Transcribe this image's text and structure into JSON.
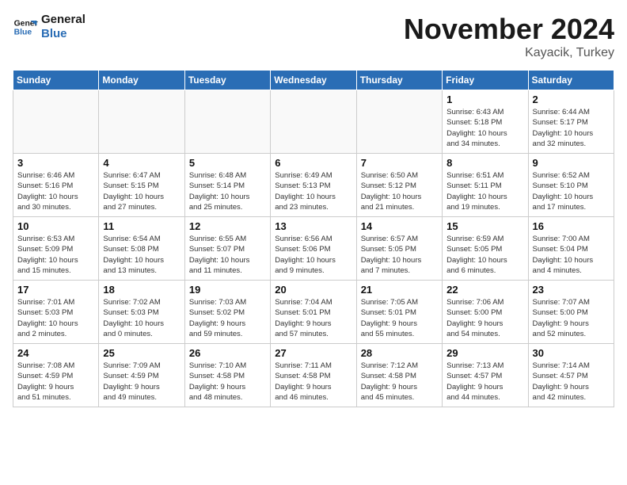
{
  "logo": {
    "line1": "General",
    "line2": "Blue"
  },
  "title": "November 2024",
  "location": "Kayacik, Turkey",
  "weekdays": [
    "Sunday",
    "Monday",
    "Tuesday",
    "Wednesday",
    "Thursday",
    "Friday",
    "Saturday"
  ],
  "weeks": [
    [
      {
        "day": "",
        "info": ""
      },
      {
        "day": "",
        "info": ""
      },
      {
        "day": "",
        "info": ""
      },
      {
        "day": "",
        "info": ""
      },
      {
        "day": "",
        "info": ""
      },
      {
        "day": "1",
        "info": "Sunrise: 6:43 AM\nSunset: 5:18 PM\nDaylight: 10 hours\nand 34 minutes."
      },
      {
        "day": "2",
        "info": "Sunrise: 6:44 AM\nSunset: 5:17 PM\nDaylight: 10 hours\nand 32 minutes."
      }
    ],
    [
      {
        "day": "3",
        "info": "Sunrise: 6:46 AM\nSunset: 5:16 PM\nDaylight: 10 hours\nand 30 minutes."
      },
      {
        "day": "4",
        "info": "Sunrise: 6:47 AM\nSunset: 5:15 PM\nDaylight: 10 hours\nand 27 minutes."
      },
      {
        "day": "5",
        "info": "Sunrise: 6:48 AM\nSunset: 5:14 PM\nDaylight: 10 hours\nand 25 minutes."
      },
      {
        "day": "6",
        "info": "Sunrise: 6:49 AM\nSunset: 5:13 PM\nDaylight: 10 hours\nand 23 minutes."
      },
      {
        "day": "7",
        "info": "Sunrise: 6:50 AM\nSunset: 5:12 PM\nDaylight: 10 hours\nand 21 minutes."
      },
      {
        "day": "8",
        "info": "Sunrise: 6:51 AM\nSunset: 5:11 PM\nDaylight: 10 hours\nand 19 minutes."
      },
      {
        "day": "9",
        "info": "Sunrise: 6:52 AM\nSunset: 5:10 PM\nDaylight: 10 hours\nand 17 minutes."
      }
    ],
    [
      {
        "day": "10",
        "info": "Sunrise: 6:53 AM\nSunset: 5:09 PM\nDaylight: 10 hours\nand 15 minutes."
      },
      {
        "day": "11",
        "info": "Sunrise: 6:54 AM\nSunset: 5:08 PM\nDaylight: 10 hours\nand 13 minutes."
      },
      {
        "day": "12",
        "info": "Sunrise: 6:55 AM\nSunset: 5:07 PM\nDaylight: 10 hours\nand 11 minutes."
      },
      {
        "day": "13",
        "info": "Sunrise: 6:56 AM\nSunset: 5:06 PM\nDaylight: 10 hours\nand 9 minutes."
      },
      {
        "day": "14",
        "info": "Sunrise: 6:57 AM\nSunset: 5:05 PM\nDaylight: 10 hours\nand 7 minutes."
      },
      {
        "day": "15",
        "info": "Sunrise: 6:59 AM\nSunset: 5:05 PM\nDaylight: 10 hours\nand 6 minutes."
      },
      {
        "day": "16",
        "info": "Sunrise: 7:00 AM\nSunset: 5:04 PM\nDaylight: 10 hours\nand 4 minutes."
      }
    ],
    [
      {
        "day": "17",
        "info": "Sunrise: 7:01 AM\nSunset: 5:03 PM\nDaylight: 10 hours\nand 2 minutes."
      },
      {
        "day": "18",
        "info": "Sunrise: 7:02 AM\nSunset: 5:03 PM\nDaylight: 10 hours\nand 0 minutes."
      },
      {
        "day": "19",
        "info": "Sunrise: 7:03 AM\nSunset: 5:02 PM\nDaylight: 9 hours\nand 59 minutes."
      },
      {
        "day": "20",
        "info": "Sunrise: 7:04 AM\nSunset: 5:01 PM\nDaylight: 9 hours\nand 57 minutes."
      },
      {
        "day": "21",
        "info": "Sunrise: 7:05 AM\nSunset: 5:01 PM\nDaylight: 9 hours\nand 55 minutes."
      },
      {
        "day": "22",
        "info": "Sunrise: 7:06 AM\nSunset: 5:00 PM\nDaylight: 9 hours\nand 54 minutes."
      },
      {
        "day": "23",
        "info": "Sunrise: 7:07 AM\nSunset: 5:00 PM\nDaylight: 9 hours\nand 52 minutes."
      }
    ],
    [
      {
        "day": "24",
        "info": "Sunrise: 7:08 AM\nSunset: 4:59 PM\nDaylight: 9 hours\nand 51 minutes."
      },
      {
        "day": "25",
        "info": "Sunrise: 7:09 AM\nSunset: 4:59 PM\nDaylight: 9 hours\nand 49 minutes."
      },
      {
        "day": "26",
        "info": "Sunrise: 7:10 AM\nSunset: 4:58 PM\nDaylight: 9 hours\nand 48 minutes."
      },
      {
        "day": "27",
        "info": "Sunrise: 7:11 AM\nSunset: 4:58 PM\nDaylight: 9 hours\nand 46 minutes."
      },
      {
        "day": "28",
        "info": "Sunrise: 7:12 AM\nSunset: 4:58 PM\nDaylight: 9 hours\nand 45 minutes."
      },
      {
        "day": "29",
        "info": "Sunrise: 7:13 AM\nSunset: 4:57 PM\nDaylight: 9 hours\nand 44 minutes."
      },
      {
        "day": "30",
        "info": "Sunrise: 7:14 AM\nSunset: 4:57 PM\nDaylight: 9 hours\nand 42 minutes."
      }
    ]
  ]
}
